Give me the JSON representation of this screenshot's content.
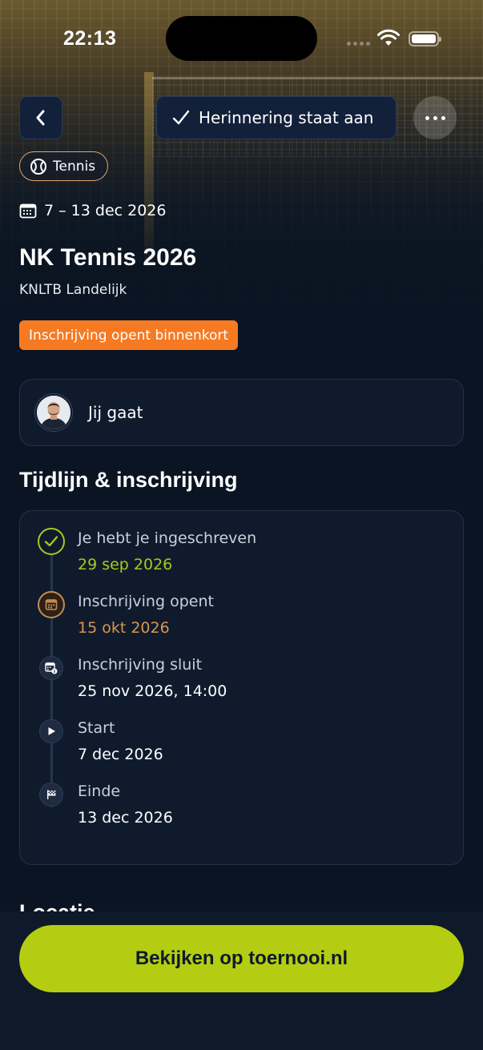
{
  "status_bar": {
    "time": "22:13"
  },
  "header": {
    "reminder_label": "Herinnering staat aan"
  },
  "event": {
    "sport": "Tennis",
    "dates": "7 – 13 dec 2026",
    "title": "NK Tennis 2026",
    "organizer": "KNLTB Landelijk",
    "status": "Inschrijving opent binnenkort"
  },
  "attendance": {
    "label": "Jij gaat"
  },
  "timeline": {
    "title": "Tijdlijn & inschrijving",
    "items": [
      {
        "label": "Je hebt je ingeschreven",
        "date": "29 sep 2026",
        "icon": "check-icon"
      },
      {
        "label": "Inschrijving opent",
        "date": "15 okt 2026",
        "icon": "calendar-icon"
      },
      {
        "label": "Inschrijving sluit",
        "date": "25 nov 2026, 14:00",
        "icon": "calendar-info-icon"
      },
      {
        "label": "Start",
        "date": "7 dec 2026",
        "icon": "play-icon"
      },
      {
        "label": "Einde",
        "date": "13 dec 2026",
        "icon": "finish-flag-icon"
      }
    ]
  },
  "next_section": {
    "title": "Locatie"
  },
  "cta": {
    "label": "Bekijken op toernooi.nl"
  },
  "colors": {
    "background": "#0a1422",
    "accent_lime": "#b4cd12",
    "status_orange": "#f57a22",
    "done_green": "#a9c71c",
    "open_orange": "#d9954f"
  }
}
